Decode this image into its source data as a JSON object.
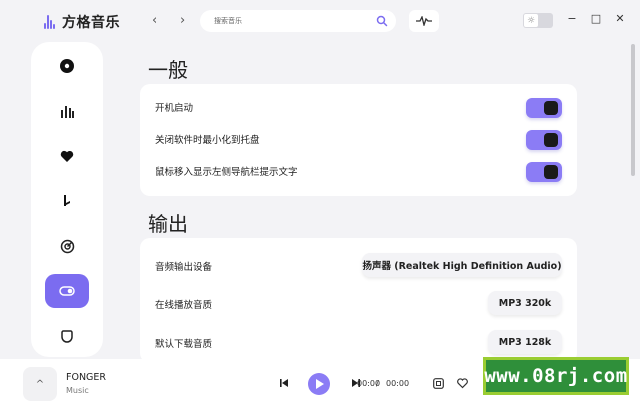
{
  "app": {
    "name": "方格音乐"
  },
  "search": {
    "placeholder": "搜索音乐"
  },
  "sections": {
    "general": {
      "title": "一般",
      "rows": [
        {
          "label": "开机启动",
          "enabled": true
        },
        {
          "label": "关闭软件时最小化到托盘",
          "enabled": true
        },
        {
          "label": "鼠标移入显示左侧导航栏提示文字",
          "enabled": true
        }
      ]
    },
    "output": {
      "title": "输出",
      "rows": [
        {
          "label": "音频输出设备",
          "value": "扬声器 (Realtek High Definition Audio)"
        },
        {
          "label": "在线播放音质",
          "value": "MP3 320k"
        },
        {
          "label": "默认下载音质",
          "value": "MP3 128k"
        }
      ]
    }
  },
  "sidebar": {
    "items": [
      {
        "icon": "disc-icon"
      },
      {
        "icon": "chart-bars-icon"
      },
      {
        "icon": "heart-icon"
      },
      {
        "icon": "music-note-icon"
      },
      {
        "icon": "target-icon"
      },
      {
        "icon": "toggle-settings-icon",
        "active": true
      },
      {
        "icon": "shield-icon"
      }
    ]
  },
  "player": {
    "title": "FONGER",
    "artist": "Music",
    "current_time": "00:00",
    "separator": "/",
    "total_time": "00:00",
    "expand_glyph": "^"
  },
  "watermark": {
    "text": "www.08rj.com"
  },
  "colors": {
    "accent": "#7b6cf0",
    "toggle": "#8b7cf5",
    "background": "#f3f3f6"
  }
}
